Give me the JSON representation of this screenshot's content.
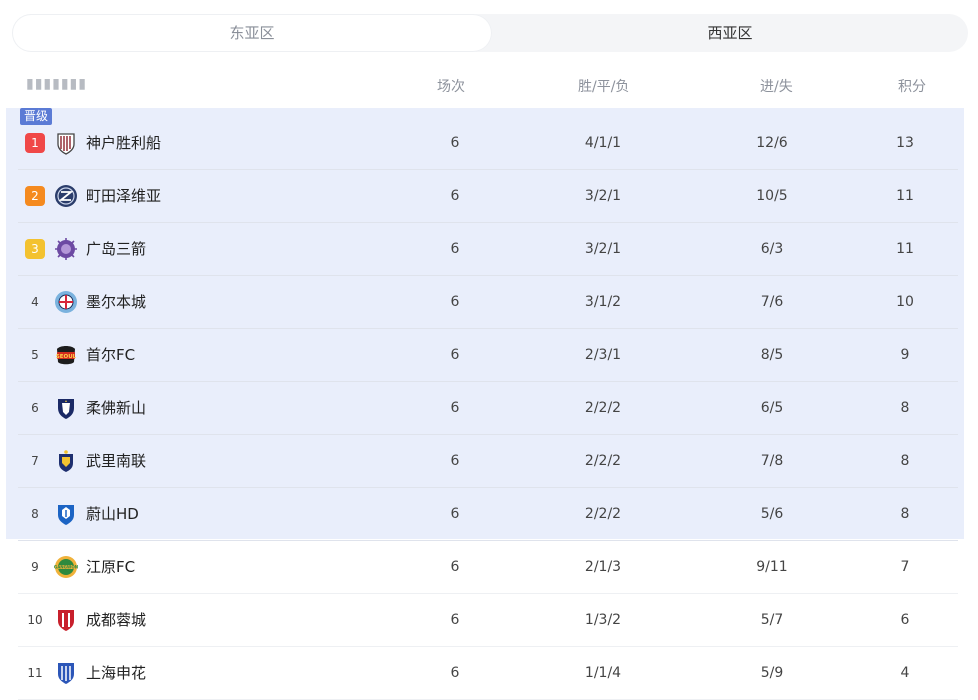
{
  "tabs": {
    "east": "东亚区",
    "west": "西亚区"
  },
  "header": {
    "team": "球队",
    "played": "场次",
    "wdl": "胜/平/负",
    "goals": "进/失",
    "points": "积分"
  },
  "zone_label": "晋级",
  "colors": {
    "promotion_bg": "#e9eefb",
    "rank1": "#f04848",
    "rank2": "#f58a1f",
    "rank3": "#f3c230",
    "tag": "#5b7bd5"
  },
  "rows": [
    {
      "rank": "1",
      "name": "神户胜利船",
      "played": "6",
      "wdl": "4/1/1",
      "goals": "12/6",
      "points": "13",
      "icon": "kobe-crest-icon"
    },
    {
      "rank": "2",
      "name": "町田泽维亚",
      "played": "6",
      "wdl": "3/2/1",
      "goals": "10/5",
      "points": "11",
      "icon": "machida-crest-icon"
    },
    {
      "rank": "3",
      "name": "广岛三箭",
      "played": "6",
      "wdl": "3/2/1",
      "goals": "6/3",
      "points": "11",
      "icon": "hiroshima-crest-icon"
    },
    {
      "rank": "4",
      "name": "墨尔本城",
      "played": "6",
      "wdl": "3/1/2",
      "goals": "7/6",
      "points": "10",
      "icon": "melbourne-crest-icon"
    },
    {
      "rank": "5",
      "name": "首尔FC",
      "played": "6",
      "wdl": "2/3/1",
      "goals": "8/5",
      "points": "9",
      "icon": "seoul-crest-icon"
    },
    {
      "rank": "6",
      "name": "柔佛新山",
      "played": "6",
      "wdl": "2/2/2",
      "goals": "6/5",
      "points": "8",
      "icon": "johor-crest-icon"
    },
    {
      "rank": "7",
      "name": "武里南联",
      "played": "6",
      "wdl": "2/2/2",
      "goals": "7/8",
      "points": "8",
      "icon": "buriram-crest-icon"
    },
    {
      "rank": "8",
      "name": "蔚山HD",
      "played": "6",
      "wdl": "2/2/2",
      "goals": "5/6",
      "points": "8",
      "icon": "ulsan-crest-icon"
    },
    {
      "rank": "9",
      "name": "江原FC",
      "played": "6",
      "wdl": "2/1/3",
      "goals": "9/11",
      "points": "7",
      "icon": "gangwon-crest-icon"
    },
    {
      "rank": "10",
      "name": "成都蓉城",
      "played": "6",
      "wdl": "1/3/2",
      "goals": "5/7",
      "points": "6",
      "icon": "chengdu-crest-icon"
    },
    {
      "rank": "11",
      "name": "上海申花",
      "played": "6",
      "wdl": "1/1/4",
      "goals": "5/9",
      "points": "4",
      "icon": "shenhua-crest-icon"
    }
  ]
}
